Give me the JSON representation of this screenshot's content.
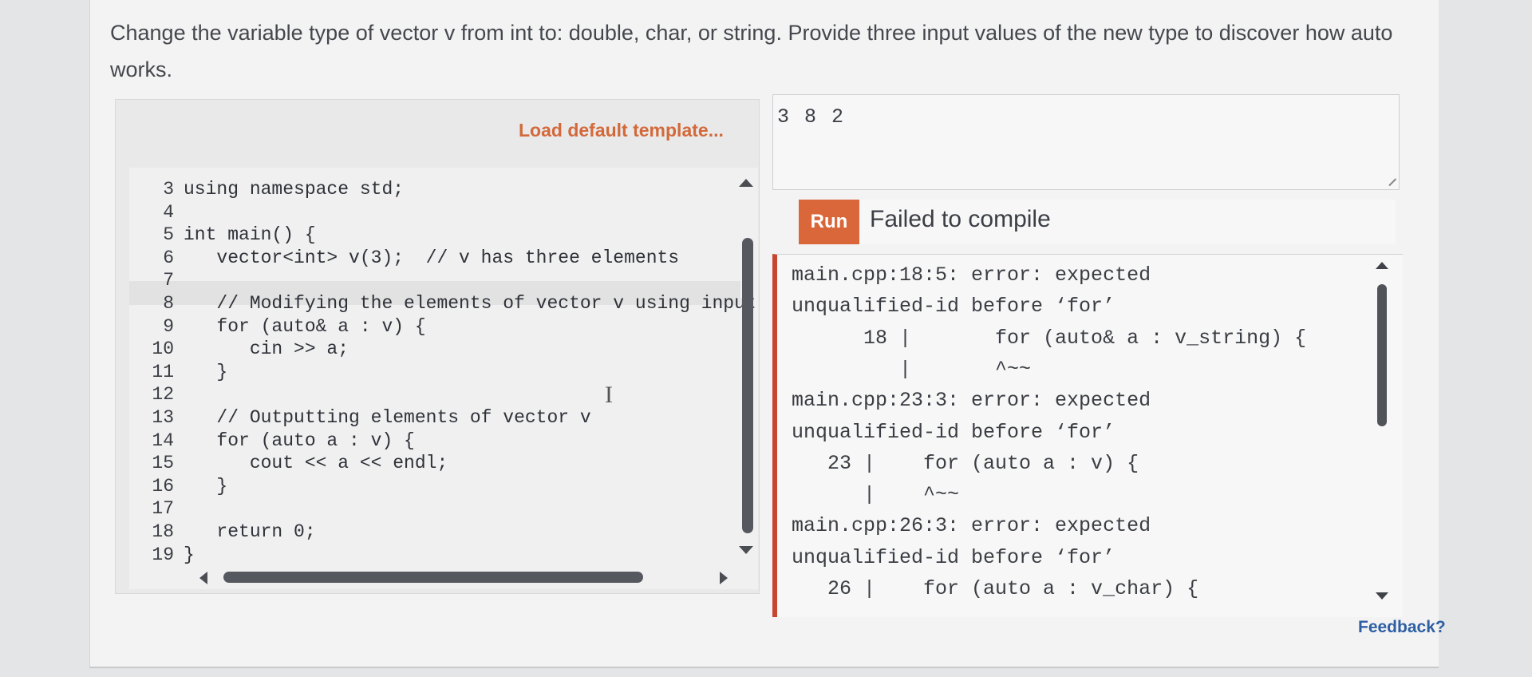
{
  "instructions": "Change the variable type of vector v from int to: double, char, or string. Provide three input values of the new type to discover how auto works.",
  "editor": {
    "load_template_label": "Load default template...",
    "lines": [
      {
        "num": "3",
        "text": "using namespace std;"
      },
      {
        "num": "4",
        "text": ""
      },
      {
        "num": "5",
        "text": "int main() {"
      },
      {
        "num": "6",
        "text": "   vector<int> v(3);  // v has three elements"
      },
      {
        "num": "7",
        "text": ""
      },
      {
        "num": "8",
        "text": "   // Modifying the elements of vector v using input"
      },
      {
        "num": "9",
        "text": "   for (auto& a : v) {"
      },
      {
        "num": "10",
        "text": "      cin >> a;"
      },
      {
        "num": "11",
        "text": "   }"
      },
      {
        "num": "12",
        "text": ""
      },
      {
        "num": "13",
        "text": "   // Outputting elements of vector v"
      },
      {
        "num": "14",
        "text": "   for (auto a : v) {"
      },
      {
        "num": "15",
        "text": "      cout << a << endl;"
      },
      {
        "num": "16",
        "text": "   }"
      },
      {
        "num": "17",
        "text": ""
      },
      {
        "num": "18",
        "text": "   return 0;"
      },
      {
        "num": "19",
        "text": "}"
      }
    ]
  },
  "input": {
    "value": "3 8 2"
  },
  "run": {
    "label": "Run",
    "status": "Failed to compile"
  },
  "output_lines": [
    "main.cpp:18:5: error: expected",
    "unqualified-id before ‘for’",
    "      18 |       for (auto& a : v_string) {",
    "         |       ^~~",
    "main.cpp:23:3: error: expected",
    "unqualified-id before ‘for’",
    "   23 |    for (auto a : v) {",
    "      |    ^~~",
    "main.cpp:26:3: error: expected",
    "unqualified-id before ‘for’",
    "   26 |    for (auto a : v_char) {"
  ],
  "feedback_label": "Feedback?",
  "colors": {
    "accent": "#d9673a",
    "error_border": "#c8452f",
    "link": "#2e5fa3"
  }
}
